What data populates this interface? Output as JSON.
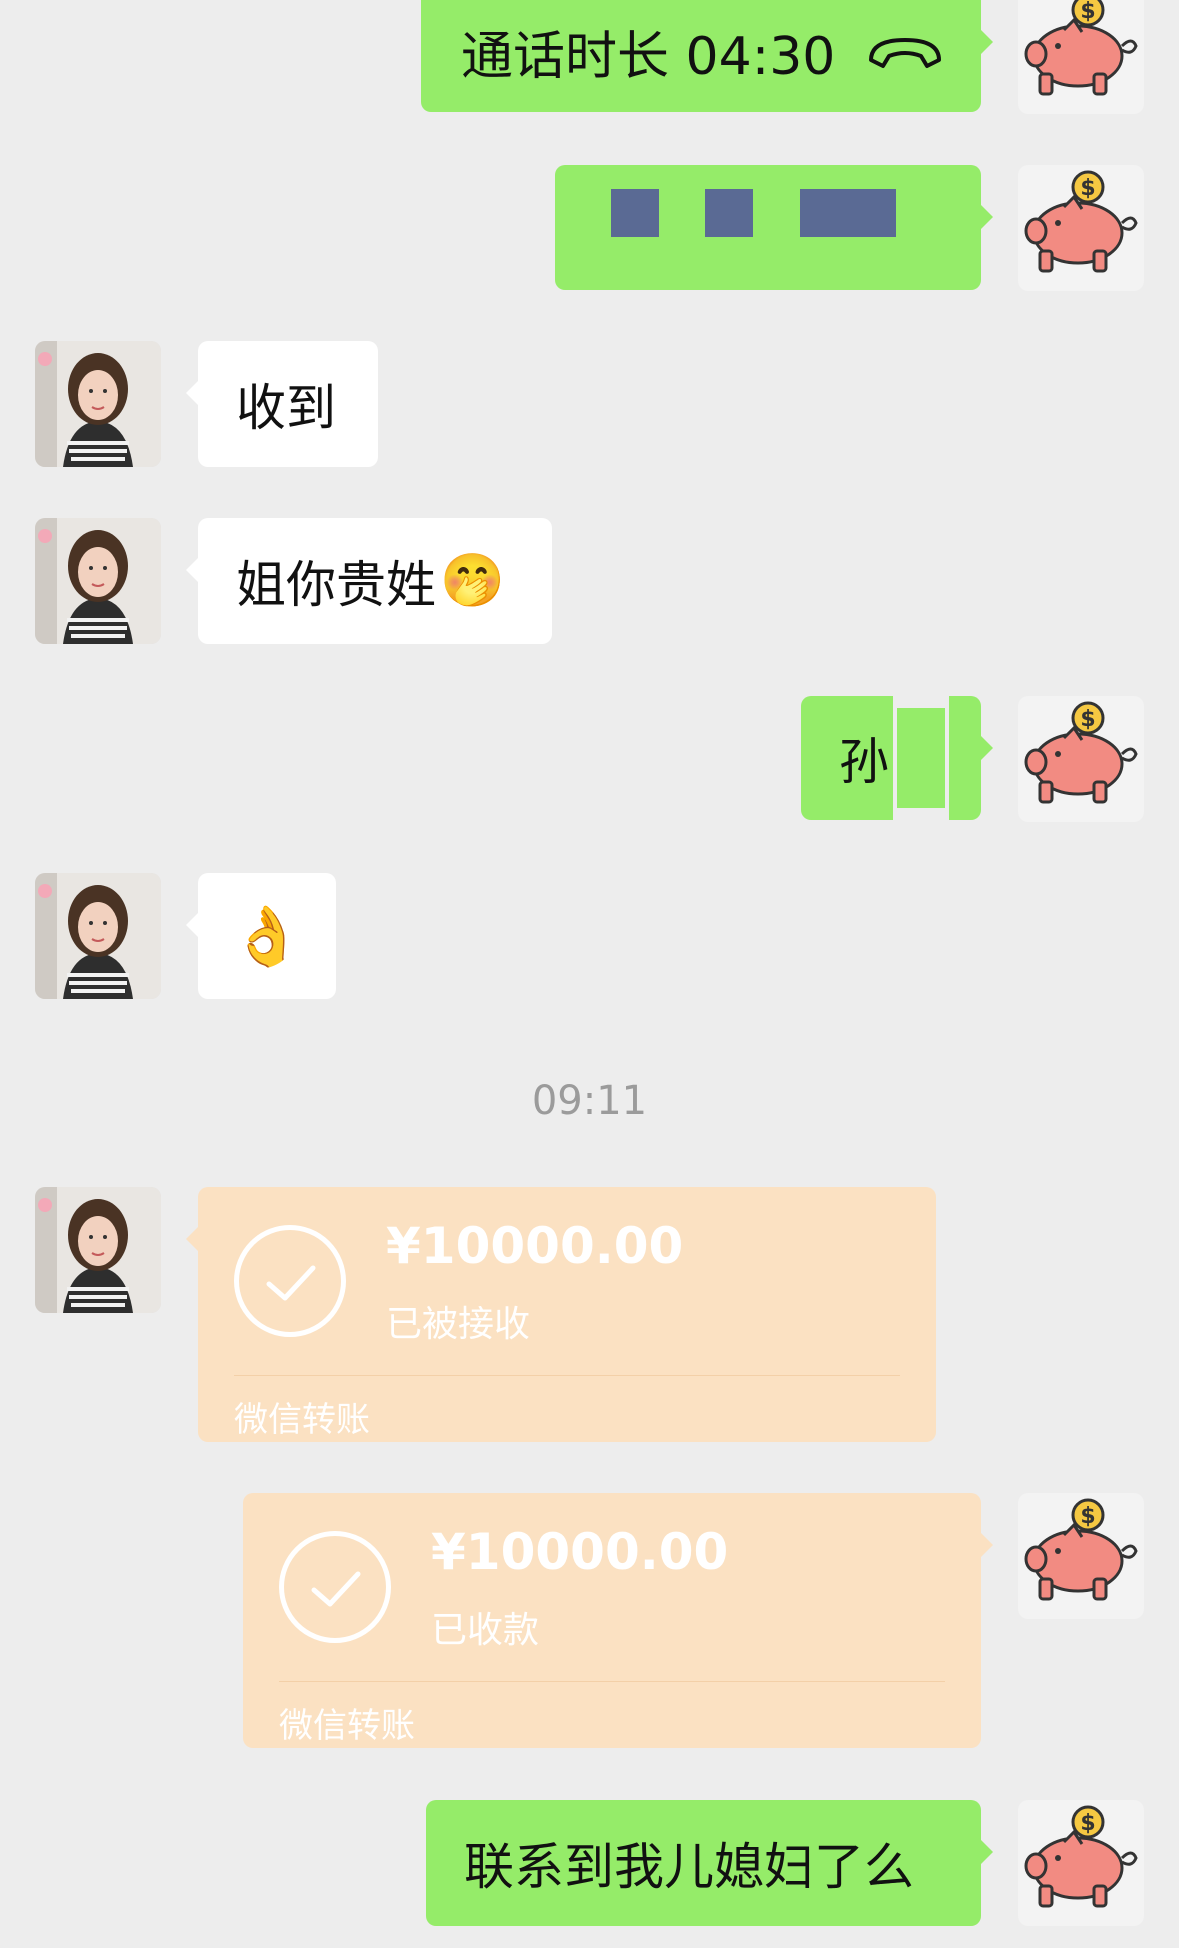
{
  "messages": {
    "call": {
      "label": "通话时长 04:30",
      "icon": "phone-hangup-icon"
    },
    "received": "收到",
    "ask_name": "姐你贵姓",
    "ask_name_emoji": "🤭",
    "reply_name": "孙",
    "ok_emoji": "👌",
    "last": "联系到我儿媳妇了么"
  },
  "timestamp": "09:11",
  "transfer_incoming": {
    "amount": "¥10000.00",
    "status": "已被接收",
    "brand": "微信转账"
  },
  "transfer_outgoing": {
    "amount": "¥10000.00",
    "status": "已收款",
    "brand": "微信转账"
  },
  "colors": {
    "background": "#ededed",
    "sent_bubble": "#95ec69",
    "received_bubble": "#ffffff",
    "transfer_card": "#fbe1c2",
    "redaction": "#5a6a94"
  }
}
